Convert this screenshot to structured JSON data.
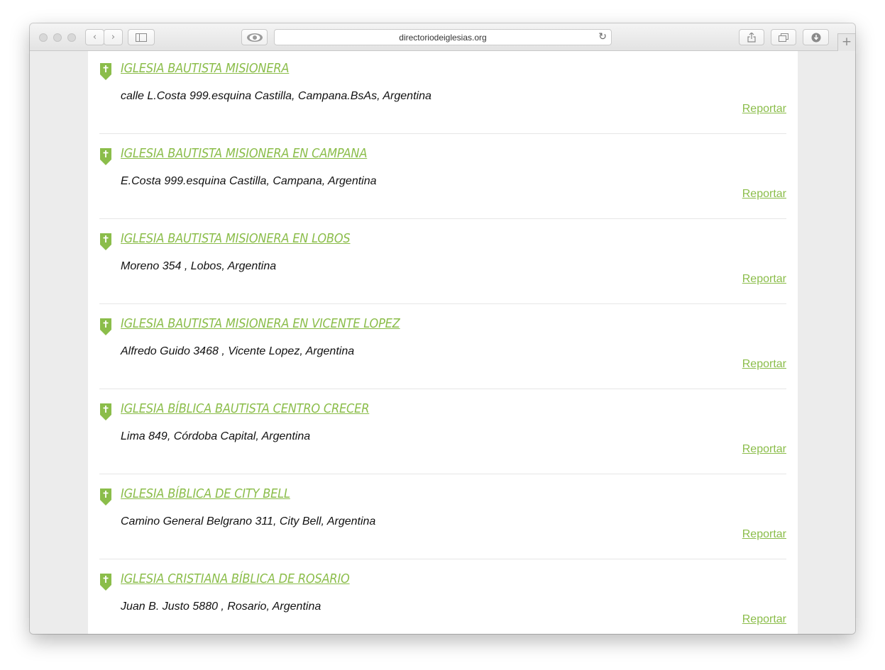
{
  "browser": {
    "url": "directoriodeiglesias.org"
  },
  "colors": {
    "accent_green": "#8bbd4a",
    "page_bg": "#ffffff",
    "gutter_bg": "#ececec"
  },
  "icons": {
    "listing_marker": "church-pin-icon"
  },
  "listings": [
    {
      "name": "IGLESIA BAUTISTA MISIONERA",
      "address": "calle L.Costa 999.esquina Castilla, Campana.BsAs, Argentina",
      "report_label": "Reportar"
    },
    {
      "name": "IGLESIA BAUTISTA MISIONERA EN CAMPANA",
      "address": "E.Costa 999.esquina Castilla, Campana, Argentina",
      "report_label": "Reportar"
    },
    {
      "name": "IGLESIA BAUTISTA MISIONERA EN LOBOS",
      "address": "Moreno 354 , Lobos, Argentina",
      "report_label": "Reportar"
    },
    {
      "name": "IGLESIA BAUTISTA MISIONERA EN VICENTE LOPEZ",
      "address": "Alfredo Guido 3468 , Vicente Lopez, Argentina",
      "report_label": "Reportar"
    },
    {
      "name": "IGLESIA BÍBLICA BAUTISTA CENTRO CRECER",
      "address": "Lima 849, Córdoba Capital, Argentina",
      "report_label": "Reportar"
    },
    {
      "name": "IGLESIA BÍBLICA DE CITY BELL",
      "address": "Camino General Belgrano 311, City Bell, Argentina",
      "report_label": "Reportar"
    },
    {
      "name": "IGLESIA CRISTIANA BÍBLICA DE ROSARIO",
      "address": "Juan B. Justo 5880 , Rosario, Argentina",
      "report_label": "Reportar"
    }
  ]
}
